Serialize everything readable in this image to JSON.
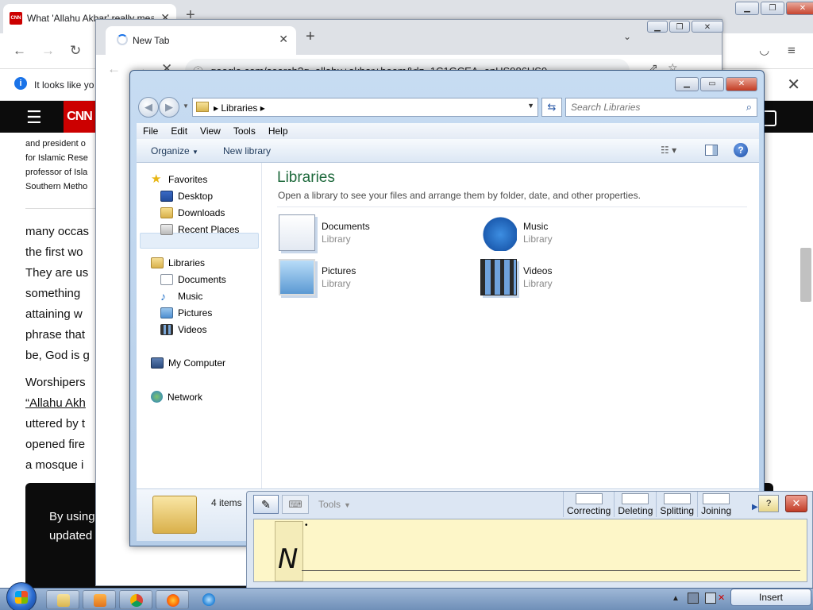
{
  "bg_browser": {
    "tab_title": "What 'Allahu Akbar' really mea",
    "favicon": "CNN",
    "info_bar": "It looks like yo",
    "cnn_logo": "CNN",
    "bio_lines": [
      "and president o",
      "for Islamic Rese",
      "professor of Isla",
      "Southern Metho"
    ],
    "paragraph1": [
      "many occas",
      "the first wo",
      "They are us",
      "something",
      "attaining w",
      "phrase that",
      "be, God is g"
    ],
    "paragraph2_lines": [
      "Worshipers",
      "“Allahu Akh",
      "uttered by t",
      "opened fire",
      "a mosque i"
    ],
    "cookie_line1": "By using",
    "cookie_line2": "updated"
  },
  "mid_browser": {
    "tab_title": "New Tab",
    "url": "google.com/search?q=allahu+akbar+boom&rlz=1C1GCEA_enUS986US9"
  },
  "explorer": {
    "address": "Libraries",
    "search_placeholder": "Search Libraries",
    "menu": [
      "File",
      "Edit",
      "View",
      "Tools",
      "Help"
    ],
    "cmd_organize": "Organize",
    "cmd_new_library": "New library",
    "nav": {
      "favorites": "Favorites",
      "desktop": "Desktop",
      "downloads": "Downloads",
      "recent": "Recent Places",
      "libraries": "Libraries",
      "documents": "Documents",
      "music": "Music",
      "pictures": "Pictures",
      "videos": "Videos",
      "computer": "My Computer",
      "network": "Network"
    },
    "heading": "Libraries",
    "subheading": "Open a library to see your files and arrange them by folder, date, and other properties.",
    "libraries": [
      {
        "name": "Documents",
        "type": "Library"
      },
      {
        "name": "Music",
        "type": "Library"
      },
      {
        "name": "Pictures",
        "type": "Library"
      },
      {
        "name": "Videos",
        "type": "Library"
      }
    ],
    "item_count": "4 items"
  },
  "input_panel": {
    "tools_label": "Tools",
    "actions": [
      "Correcting",
      "Deleting",
      "Splitting",
      "Joining"
    ],
    "handwriting": "N",
    "insert_label": "Insert"
  }
}
